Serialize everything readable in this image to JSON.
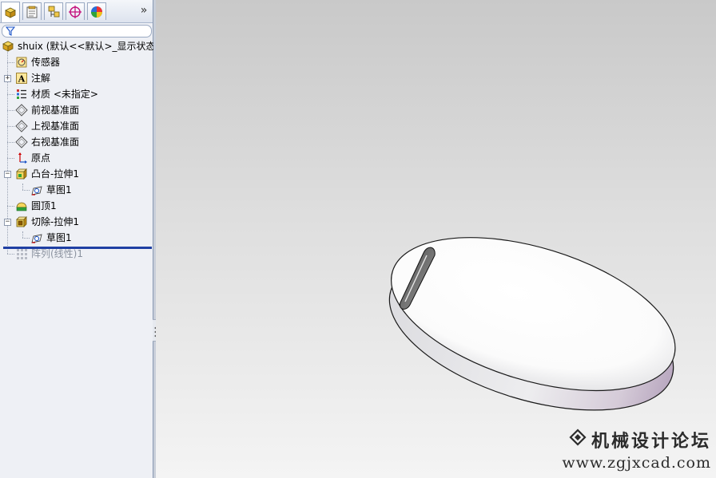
{
  "feature_manager": {
    "tabs": [
      {
        "icon": "feature-manager-icon",
        "active": true
      },
      {
        "icon": "property-manager-icon",
        "active": false
      },
      {
        "icon": "configuration-manager-icon",
        "active": false
      },
      {
        "icon": "dimxpert-manager-icon",
        "active": false
      },
      {
        "icon": "display-manager-icon",
        "active": false
      }
    ],
    "more": "»",
    "filter_icon": "filter-icon",
    "root": {
      "label": "shuix  (默认<<默认>_显示状态",
      "icon": "part-icon"
    },
    "items": [
      {
        "label": "传感器",
        "icon": "sensor-icon"
      },
      {
        "label": "注解",
        "icon": "annotation-icon"
      },
      {
        "label": "材质 <未指定>",
        "icon": "material-icon"
      },
      {
        "label": "前视基准面",
        "icon": "plane-icon"
      },
      {
        "label": "上视基准面",
        "icon": "plane-icon"
      },
      {
        "label": "右视基准面",
        "icon": "plane-icon"
      },
      {
        "label": "原点",
        "icon": "origin-icon"
      },
      {
        "label": "凸台-拉伸1",
        "icon": "boss-extrude-icon"
      },
      {
        "label": "草图1",
        "icon": "sketch-icon"
      },
      {
        "label": "圆顶1",
        "icon": "dome-icon"
      },
      {
        "label": "切除-拉伸1",
        "icon": "cut-extrude-icon"
      },
      {
        "label": "草图1",
        "icon": "sketch-icon"
      },
      {
        "label": "阵列(线性)1",
        "icon": "linear-pattern-icon",
        "suppressed": true
      }
    ]
  },
  "watermark": {
    "title": "机械设计论坛",
    "url": "www.zgjxcad.com",
    "logo_icon": "forum-logo-icon"
  }
}
